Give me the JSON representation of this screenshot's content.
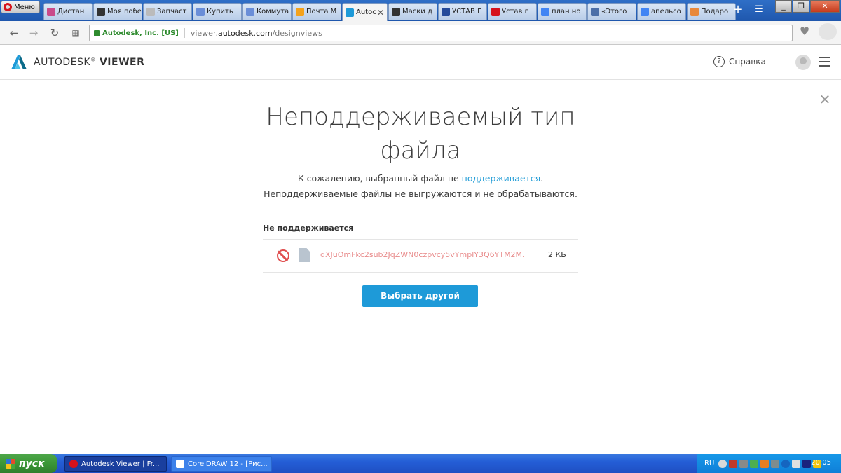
{
  "browser": {
    "menu_label": "Меню",
    "tabs": [
      {
        "label": "Дистан",
        "color": "#c94a8a"
      },
      {
        "label": "Моя побе",
        "color": "#333333"
      },
      {
        "label": "Запчаст",
        "color": "#bbbbbb"
      },
      {
        "label": "Купить",
        "color": "#6a8ed8"
      },
      {
        "label": "Коммута",
        "color": "#6a8ed8"
      },
      {
        "label": "Почта М",
        "color": "#f4a21c"
      },
      {
        "label": "Autoc",
        "color": "#1e9ad8",
        "active": true
      },
      {
        "label": "Маски д",
        "color": "#333333"
      },
      {
        "label": "УСТАВ Г",
        "color": "#244a9a"
      },
      {
        "label": "Устав г",
        "color": "#d6121b"
      },
      {
        "label": "план но",
        "color": "#4285f4"
      },
      {
        "label": "«Этого",
        "color": "#4c6fa8"
      },
      {
        "label": "апельсо",
        "color": "#4285f4"
      },
      {
        "label": "Подаро",
        "color": "#e8883a"
      }
    ],
    "secure_label": "Autodesk, Inc. [US]",
    "url_prefix": "viewer.",
    "url_domain": "autodesk.com",
    "url_path": "/designviews"
  },
  "header": {
    "brand_regular": "AUTODESK",
    "brand_mark": "®",
    "brand_bold": " VIEWER",
    "help_label": "Справка"
  },
  "dialog": {
    "title": "Неподдерживаемый тип файла",
    "message_prefix": "К сожалению, выбранный файл не ",
    "message_link": "поддерживается",
    "message_suffix": ".",
    "message_line2": "Неподдерживаемые файлы не выгружаются и не обрабатываются.",
    "list_header": "Не поддерживается",
    "file": {
      "name": "dXJuOmFkc2sub2JqZWN0czpvcy5vYmplY3Q6YTM2M.",
      "size": "2 КБ"
    },
    "button_label": "Выбрать другой"
  },
  "taskbar": {
    "start_label": "пуск",
    "tasks": [
      {
        "label": "Autodesk Viewer | Fr...",
        "active": true
      },
      {
        "label": "CorelDRAW 12 - [Рис...",
        "active": false
      }
    ],
    "language": "RU",
    "clock": "20:05"
  },
  "colors": {
    "accent": "#1e9ad8",
    "error": "#e05050",
    "link": "#2aa0d8"
  }
}
